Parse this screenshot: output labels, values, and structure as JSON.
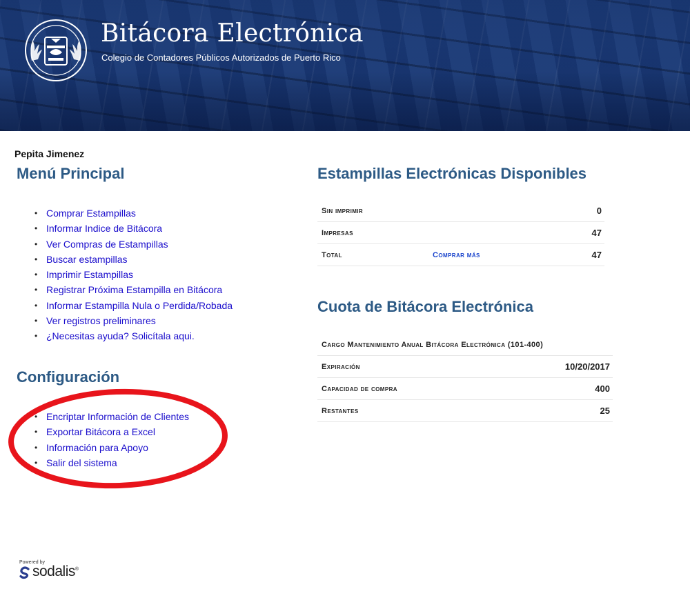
{
  "header": {
    "title": "Bitácora Electrónica",
    "subtitle": "Colegio de Contadores Públicos Autorizados de Puerto Rico"
  },
  "user": {
    "name": "Pepita Jimenez"
  },
  "main_menu": {
    "title": "Menú Principal",
    "items": [
      "Comprar Estampillas",
      "Informar Indice de Bitácora",
      "Ver Compras de Estampillas",
      "Buscar estampillas",
      "Imprimir Estampillas",
      "Registrar Próxima Estampilla en Bitácora",
      "Informar Estampilla Nula o Perdida/Robada",
      "Ver registros preliminares",
      "¿Necesitas ayuda? Solicítala aqui."
    ]
  },
  "config_menu": {
    "title": "Configuración",
    "items": [
      "Encriptar Información de Clientes",
      "Exportar Bitácora a Excel",
      "Información para Apoyo",
      "Salir del sistema"
    ]
  },
  "stamps": {
    "title": "Estampillas Electrónicas Disponibles",
    "rows": [
      {
        "label": "Sin imprimir",
        "link": "",
        "value": "0"
      },
      {
        "label": "Impresas",
        "link": "",
        "value": "47"
      },
      {
        "label": "Total",
        "link": "Comprar más",
        "value": "47"
      }
    ]
  },
  "quota": {
    "title": "Cuota de Bitácora Electrónica",
    "rows": [
      {
        "label": "Cargo Mantenimiento Anual Bitácora Electrónica (101-400)",
        "value": ""
      },
      {
        "label": "Expiración",
        "value": "10/20/2017"
      },
      {
        "label": "Capacidad de compra",
        "value": "400"
      },
      {
        "label": "Restantes",
        "value": "25"
      }
    ]
  },
  "footer": {
    "powered_by": "Powered by",
    "brand": "sodalis",
    "brand_mark": "®"
  },
  "colors": {
    "heading": "#2d5a85",
    "link": "#1a0dcc",
    "banner": "#1d3c78",
    "annotation": "#e8141b"
  },
  "icons": [
    "seal-logo-icon",
    "sodalis-logo-icon"
  ]
}
